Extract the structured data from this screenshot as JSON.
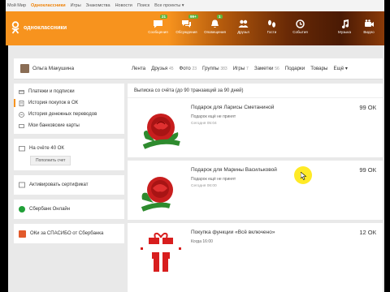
{
  "portal": {
    "links": [
      "Мой Мир",
      "Одноклассники",
      "Игры",
      "Знакомства",
      "Новости",
      "Поиск",
      "Все проекты ▾"
    ],
    "active_index": 1
  },
  "header": {
    "logo_text": "одноклассники",
    "nav": [
      {
        "label": "Сообщения",
        "badge": "21",
        "icon": "chat-icon"
      },
      {
        "label": "Обсуждения",
        "badge": "99+",
        "icon": "discussion-icon"
      },
      {
        "label": "Оповещения",
        "badge": "1",
        "icon": "bell-icon"
      },
      {
        "label": "Друзья",
        "badge": "",
        "icon": "friends-icon"
      },
      {
        "label": "Гости",
        "badge": "",
        "icon": "footprints-icon"
      },
      {
        "label": "События",
        "badge": "",
        "icon": "events-icon"
      }
    ],
    "nav_right": [
      {
        "label": "Музыка",
        "icon": "music-icon"
      },
      {
        "label": "Видео",
        "icon": "video-icon"
      }
    ]
  },
  "profile": {
    "name": "Ольга Макушина",
    "links": [
      {
        "label": "Лента",
        "count": ""
      },
      {
        "label": "Друзья",
        "count": "45"
      },
      {
        "label": "Фото",
        "count": "23"
      },
      {
        "label": "Группы",
        "count": "383"
      },
      {
        "label": "Игры",
        "count": "7"
      },
      {
        "label": "Заметки",
        "count": "56"
      },
      {
        "label": "Подарки",
        "count": ""
      },
      {
        "label": "Товары",
        "count": ""
      },
      {
        "label": "Ещё ▾",
        "count": ""
      }
    ]
  },
  "sidebar": {
    "menu": [
      {
        "label": "Платежи и подписки",
        "icon": "card-icon",
        "selected": false
      },
      {
        "label": "История покупок в ОК",
        "icon": "history-icon",
        "selected": true
      },
      {
        "label": "История денежных переводов",
        "icon": "transfer-icon",
        "selected": false
      },
      {
        "label": "Мои банковские карты",
        "icon": "bank-card-icon",
        "selected": false
      }
    ],
    "balance_label": "На счёте 40 ОК",
    "topup_label": "Пополнить счет",
    "certificate_label": "Активировать сертификат",
    "sberbank_label": "Сбербанк Онлайн",
    "spasibo_label": "ОКи за СПАСИБО от Сбербанка"
  },
  "main": {
    "heading": "Выписка со счёта (до 90 транзакций за 90 дней)",
    "transactions": [
      {
        "title": "Подарок для Ларисы Сметаниной",
        "sub": "Подарок ещё не принят",
        "date": "Сегодня 05:04",
        "price": "99 ОК",
        "icon": "rose-gift-icon"
      },
      {
        "title": "Подарок для Марины Васильковой",
        "sub": "Подарок ещё не принят",
        "date": "Сегодня 06:00",
        "price": "99 ОК",
        "icon": "rose-gift-icon"
      },
      {
        "title": "Покупка функции «Всё включено»",
        "sub": "Когда 16:00",
        "date": "",
        "price": "12 ОК",
        "icon": "gift-box-icon"
      }
    ]
  },
  "colors": {
    "accent": "#f7931e",
    "sber": "#21a038"
  }
}
